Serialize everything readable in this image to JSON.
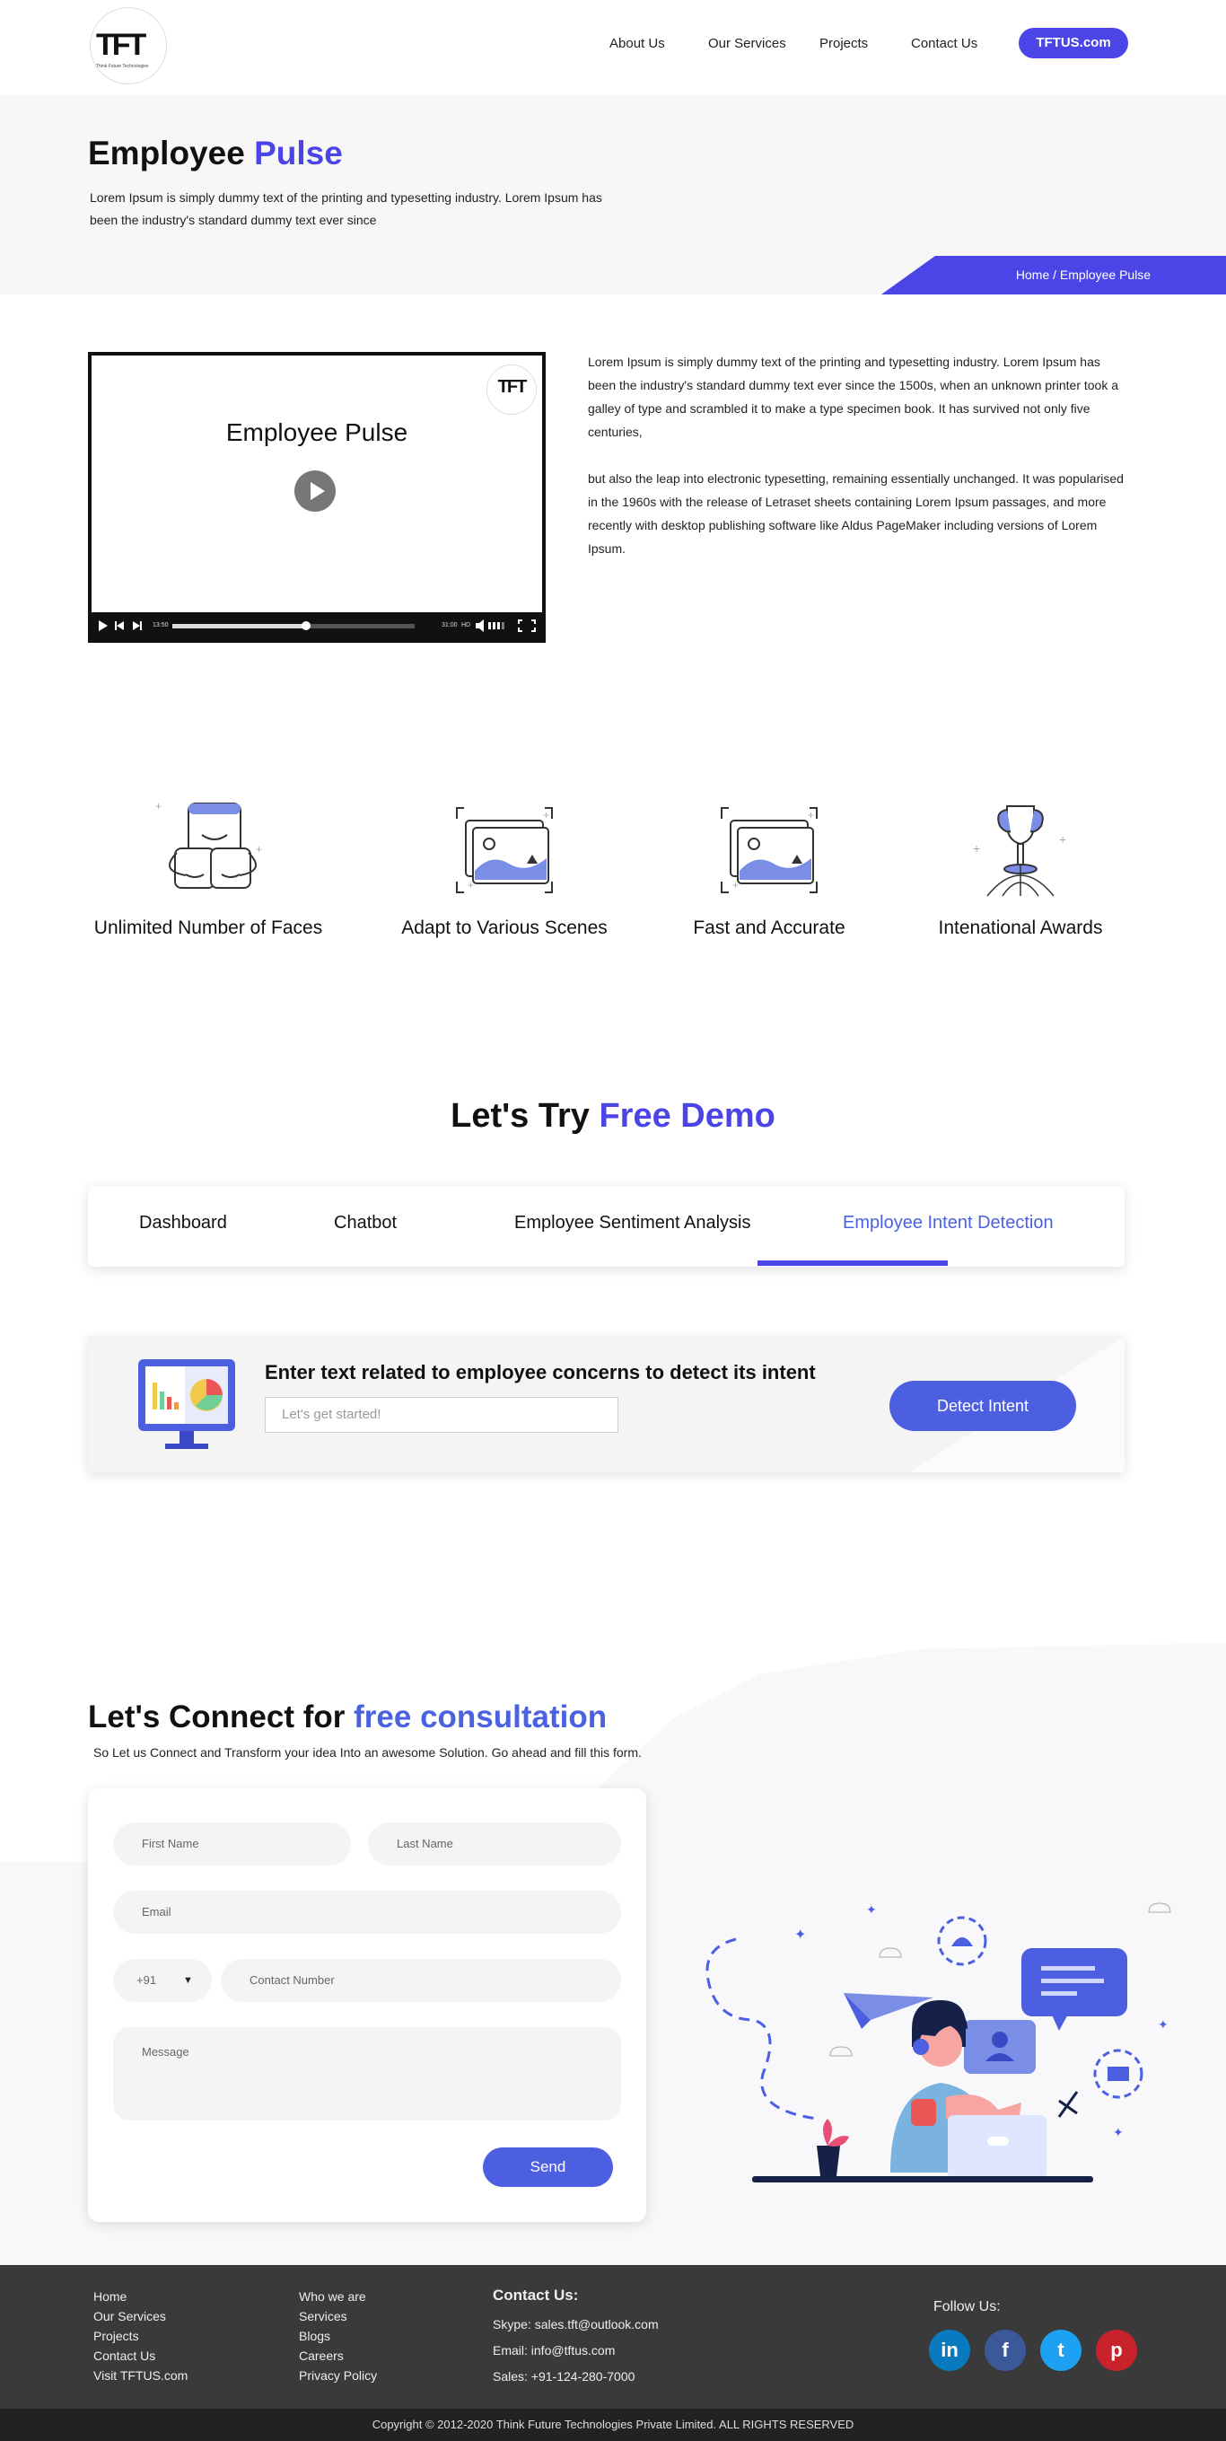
{
  "header": {
    "logo_text": "TFT",
    "logo_sub": "Think Future Technologies",
    "nav": [
      "About Us",
      "Our Services",
      "Projects",
      "Contact Us"
    ],
    "cta": "TFTUS.com"
  },
  "hero": {
    "title_part1": "Employee",
    "title_part2": "Pulse",
    "subtitle": "Lorem Ipsum is simply dummy text of the printing and typesetting industry. Lorem Ipsum has been the industry's standard dummy text ever since",
    "breadcrumb": "Home / Employee Pulse"
  },
  "video": {
    "title": "Employee Pulse",
    "logo_text": "TFT",
    "time_elapsed": "13:50",
    "time_total": "31:00",
    "hd": "HD",
    "progress": 0.55
  },
  "description": {
    "p1": "Lorem Ipsum is simply dummy text of the printing and typesetting industry. Lorem Ipsum has been the industry's standard dummy text ever since the 1500s, when an unknown printer took a galley of type and scrambled it to make a type specimen book. It has survived not only five centuries,",
    "p2": "but also the leap into electronic typesetting, remaining essentially unchanged. It was popularised in the 1960s with the release of Letraset sheets containing Lorem Ipsum passages, and more recently with desktop publishing software like Aldus PageMaker including versions of Lorem Ipsum."
  },
  "features": [
    {
      "label": "Unlimited Number of Faces",
      "icon": "faces-icon"
    },
    {
      "label": "Adapt to Various Scenes",
      "icon": "image-scene-icon"
    },
    {
      "label": "Fast and Accurate",
      "icon": "image-accurate-icon"
    },
    {
      "label": "Intenational Awards",
      "icon": "trophy-icon"
    }
  ],
  "demo": {
    "title_part1": "Let's Try",
    "title_part2": "Free Demo",
    "tabs": [
      "Dashboard",
      "Chatbot",
      "Employee Sentiment Analysis",
      "Employee Intent Detection"
    ],
    "active_tab": 3,
    "heading": "Enter text related to employee concerns to detect its intent",
    "input_placeholder": "Let's get started!",
    "button": "Detect Intent"
  },
  "connect": {
    "title_part1": "Let's Connect for",
    "title_part2": "free consultation",
    "subtitle": "So Let us Connect and Transform your idea Into an awesome Solution. Go ahead and fill this form.",
    "first_name": "First Name",
    "last_name": "Last Name",
    "email": "Email",
    "country_code": "+91",
    "contact": "Contact Number",
    "message": "Message",
    "send": "Send"
  },
  "footer": {
    "col1": [
      "Home",
      "Our Services",
      "Projects",
      "Contact Us",
      "Visit TFTUS.com"
    ],
    "col2": [
      "Who we are",
      "Services",
      "Blogs",
      "Careers",
      "Privacy Policy"
    ],
    "contact_heading": "Contact Us:",
    "skype": "Skype: sales.tft@outlook.com",
    "email": "Email: info@tftus.com",
    "sales": "Sales: +91-124-280-7000",
    "follow": "Follow Us:",
    "social": [
      "in",
      "f",
      "t",
      "p"
    ],
    "copyright": "Copyright © 2012-2020 Think Future Technologies Private Limited. ALL RIGHTS RESERVED"
  },
  "colors": {
    "accent": "#4b44e6",
    "accent_light": "#4b62e0",
    "footer": "#3a3a3a"
  }
}
